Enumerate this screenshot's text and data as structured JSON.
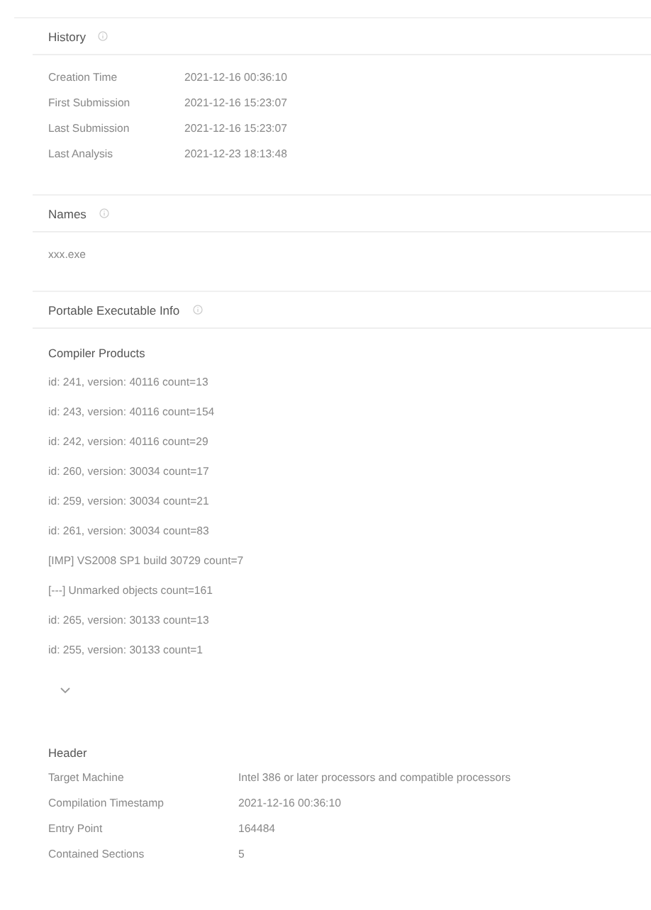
{
  "history": {
    "title": "History",
    "rows": [
      {
        "label": "Creation Time",
        "value": "2021-12-16 00:36:10"
      },
      {
        "label": "First Submission",
        "value": "2021-12-16 15:23:07"
      },
      {
        "label": "Last Submission",
        "value": "2021-12-16 15:23:07"
      },
      {
        "label": "Last Analysis",
        "value": "2021-12-23 18:13:48"
      }
    ]
  },
  "names": {
    "title": "Names",
    "items": [
      "xxx.exe"
    ]
  },
  "pe_info": {
    "title": "Portable Executable Info",
    "compiler_products": {
      "title": "Compiler Products",
      "items": [
        "id: 241, version: 40116 count=13",
        "id: 243, version: 40116 count=154",
        "id: 242, version: 40116 count=29",
        "id: 260, version: 30034 count=17",
        "id: 259, version: 30034 count=21",
        "id: 261, version: 30034 count=83",
        "[IMP] VS2008 SP1 build 30729 count=7",
        "[---] Unmarked objects count=161",
        "id: 265, version: 30133 count=13",
        "id: 255, version: 30133 count=1"
      ],
      "expanded": false
    },
    "header": {
      "title": "Header",
      "rows": [
        {
          "label": "Target Machine",
          "value": "Intel 386 or later processors and compatible processors"
        },
        {
          "label": "Compilation Timestamp",
          "value": "2021-12-16 00:36:10"
        },
        {
          "label": "Entry Point",
          "value": "164484"
        },
        {
          "label": "Contained Sections",
          "value": "5"
        }
      ]
    }
  }
}
